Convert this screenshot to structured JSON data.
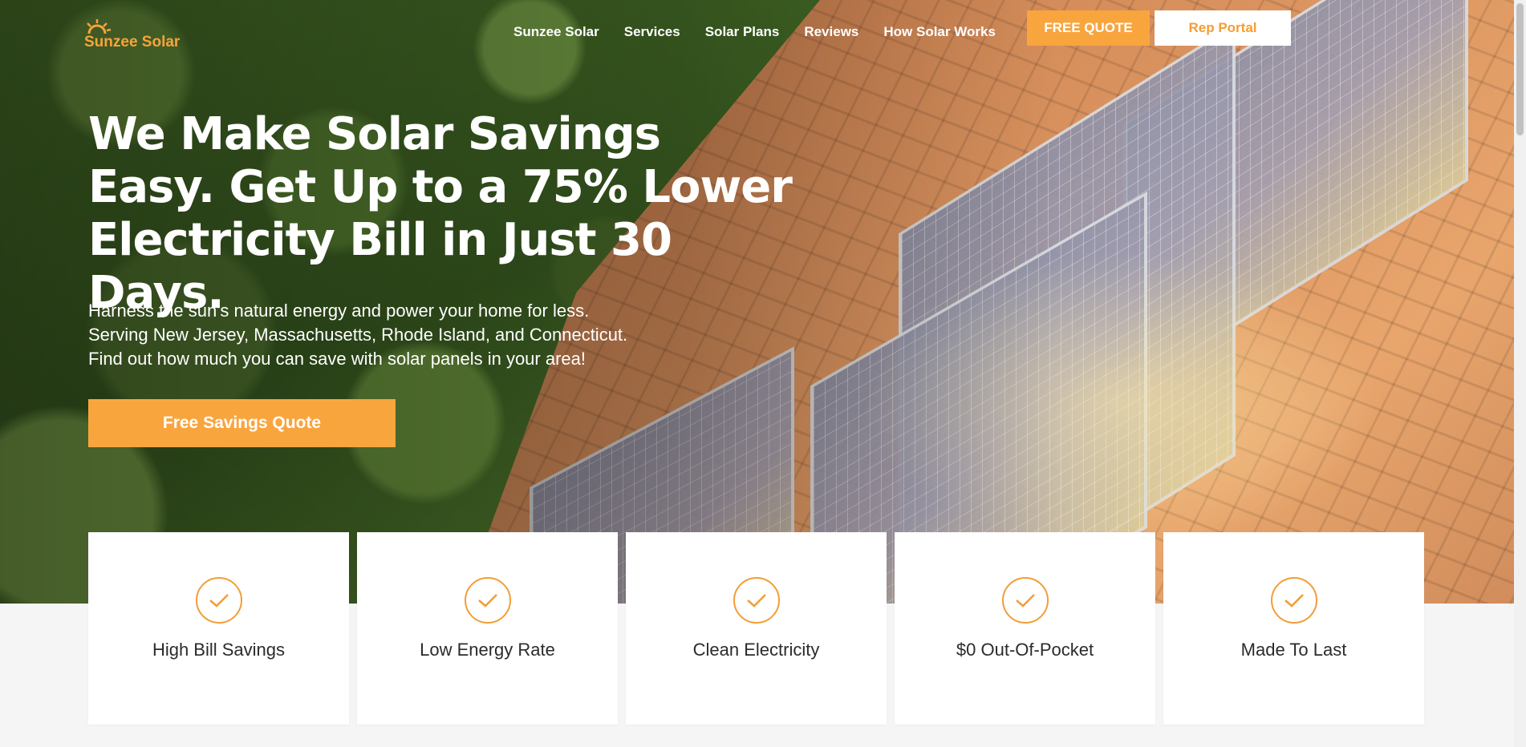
{
  "brand": {
    "name": "Sunzee Solar",
    "accent": "#f9a53e"
  },
  "nav": {
    "items": [
      "Sunzee Solar",
      "Services",
      "Solar Plans",
      "Reviews",
      "How Solar Works"
    ],
    "free_quote": "FREE QUOTE",
    "rep_portal": "Rep Portal"
  },
  "hero": {
    "headline": "We Make Solar Savings Easy. Get Up to a 75% Lower Electricity Bill in Just 30 Days.",
    "subtext": [
      "Harness the sun's natural energy and power your home for less.",
      "Serving New Jersey, Massachusetts, Rhode Island, and Connecticut.",
      "Find out how much you can save with solar panels in your area!"
    ],
    "cta": "Free Savings Quote"
  },
  "features": [
    {
      "label": "High Bill Savings",
      "icon": "check-circle-icon"
    },
    {
      "label": "Low Energy Rate",
      "icon": "check-circle-icon"
    },
    {
      "label": "Clean Electricity",
      "icon": "check-circle-icon"
    },
    {
      "label": "$0 Out-Of-Pocket",
      "icon": "check-circle-icon"
    },
    {
      "label": "Made To Last",
      "icon": "check-circle-icon"
    }
  ]
}
